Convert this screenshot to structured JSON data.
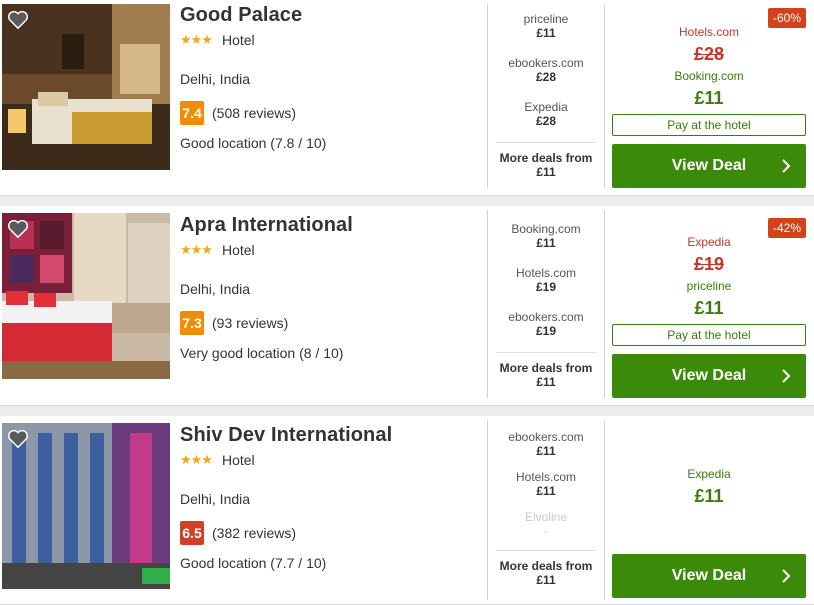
{
  "ui": {
    "more_deals_label": "More deals from",
    "view_deal_label": "View Deal",
    "pay_at_hotel_label": "Pay at the hotel",
    "star_glyphs": "★★★"
  },
  "colors": {
    "green": "#3c8a0a",
    "green_text": "#3a7d0a",
    "red": "#c0392b",
    "badge": "#d4421b",
    "star": "#f0a81e"
  },
  "hotels": [
    {
      "name": "Good Palace",
      "type": "Hotel",
      "stars": 3,
      "city": "Delhi, India",
      "score": "7.4",
      "score_color": "#f08c00",
      "reviews": "(508 reviews)",
      "location": "Good location (7.8 / 10)",
      "deals": [
        {
          "site": "priceline",
          "price": "£11"
        },
        {
          "site": "ebookers.com",
          "price": "£28"
        },
        {
          "site": "Expedia",
          "price": "£28"
        }
      ],
      "more_price": "£11",
      "discount": "-60%",
      "original_site": "Hotels.com",
      "original_price": "£28",
      "best_site": "Booking.com",
      "best_price": "£11"
    },
    {
      "name": "Apra International",
      "type": "Hotel",
      "stars": 3,
      "city": "Delhi, India",
      "score": "7.3",
      "score_color": "#f08c00",
      "reviews": "(93 reviews)",
      "location": "Very good location (8 / 10)",
      "deals": [
        {
          "site": "Booking.com",
          "price": "£11"
        },
        {
          "site": "Hotels.com",
          "price": "£19"
        },
        {
          "site": "ebookers.com",
          "price": "£19"
        }
      ],
      "more_price": "£11",
      "discount": "-42%",
      "original_site": "Expedia",
      "original_price": "£19",
      "best_site": "priceline",
      "best_price": "£11"
    },
    {
      "name": "Shiv Dev International",
      "type": "Hotel",
      "stars": 3,
      "city": "Delhi, India",
      "score": "6.5",
      "score_color": "#d0412a",
      "reviews": "(382 reviews)",
      "location": "Good location (7.7 / 10)",
      "deals": [
        {
          "site": "ebookers.com",
          "price": "£11"
        },
        {
          "site": "Hotels.com",
          "price": "£11"
        },
        {
          "site": "Elvoline",
          "price": "-"
        }
      ],
      "more_price": "£11",
      "best_site": "Expedia",
      "best_price": "£11"
    }
  ]
}
